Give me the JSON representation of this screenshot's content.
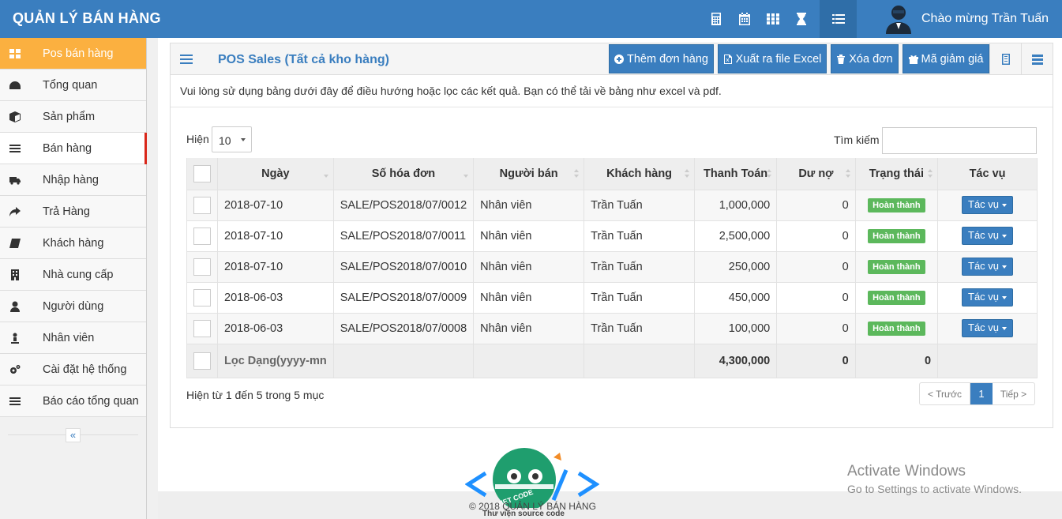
{
  "app": {
    "brand": "QUẢN LÝ BÁN HÀNG",
    "welcome": "Chào mừng Trần Tuấn",
    "top_icons": [
      "calculator-icon",
      "calendar-icon",
      "grid-icon",
      "hourglass-icon",
      "list-icon"
    ]
  },
  "sidebar": {
    "items": [
      {
        "label": "Pos bán hàng",
        "icon": "pos-icon"
      },
      {
        "label": "Tổng quan",
        "icon": "dashboard-icon"
      },
      {
        "label": "Sản phẩm",
        "icon": "box-icon"
      },
      {
        "label": "Bán hàng",
        "icon": "list-icon"
      },
      {
        "label": "Nhập hàng",
        "icon": "truck-icon"
      },
      {
        "label": "Trả Hàng",
        "icon": "share-icon"
      },
      {
        "label": "Khách hàng",
        "icon": "book-icon"
      },
      {
        "label": "Nhà cung cấp",
        "icon": "building-icon"
      },
      {
        "label": "Người dùng",
        "icon": "user-icon"
      },
      {
        "label": "Nhân viên",
        "icon": "staff-icon"
      },
      {
        "label": "Cài đặt hệ thống",
        "icon": "cogs-icon"
      },
      {
        "label": "Báo cáo tổng quan",
        "icon": "list-icon"
      }
    ],
    "collapse": "«"
  },
  "panel": {
    "title": "POS Sales (Tất cả kho hàng)",
    "buttons": {
      "add": "Thêm đơn hàng",
      "export": "Xuất ra file Excel",
      "delete": "Xóa đơn",
      "coupon": "Mã giảm giá"
    },
    "info": "Vui lòng sử dụng bảng dưới đây để điều hướng hoặc lọc các kết quả. Bạn có thể tải về bảng như excel và pdf.",
    "show_label": "Hiện",
    "page_size": "10",
    "search_label": "Tìm kiếm",
    "search_value": ""
  },
  "table": {
    "headers": [
      "Ngày",
      "Số hóa đơn",
      "Người bán",
      "Khách hàng",
      "Thanh Toán",
      "Dư nợ",
      "Trạng thái",
      "Tác vụ"
    ],
    "rows": [
      {
        "date": "2018-07-10",
        "invoice": "SALE/POS2018/07/0012",
        "seller": "Nhân viên",
        "customer": "Trần Tuấn",
        "paid": "1,000,000",
        "debt": "0",
        "status": "Hoàn thành",
        "action": "Tác vụ"
      },
      {
        "date": "2018-07-10",
        "invoice": "SALE/POS2018/07/0011",
        "seller": "Nhân viên",
        "customer": "Trần Tuấn",
        "paid": "2,500,000",
        "debt": "0",
        "status": "Hoàn thành",
        "action": "Tác vụ"
      },
      {
        "date": "2018-07-10",
        "invoice": "SALE/POS2018/07/0010",
        "seller": "Nhân viên",
        "customer": "Trần Tuấn",
        "paid": "250,000",
        "debt": "0",
        "status": "Hoàn thành",
        "action": "Tác vụ"
      },
      {
        "date": "2018-06-03",
        "invoice": "SALE/POS2018/07/0009",
        "seller": "Nhân viên",
        "customer": "Trần Tuấn",
        "paid": "450,000",
        "debt": "0",
        "status": "Hoàn thành",
        "action": "Tác vụ"
      },
      {
        "date": "2018-06-03",
        "invoice": "SALE/POS2018/07/0008",
        "seller": "Nhân viên",
        "customer": "Trần Tuấn",
        "paid": "100,000",
        "debt": "0",
        "status": "Hoàn thành",
        "action": "Tác vụ"
      }
    ],
    "footer": {
      "filter": "Lọc Dạng(yyyy-mn",
      "paid_total": "4,300,000",
      "debt_total": "0",
      "status_total": "0"
    }
  },
  "pagination": {
    "summary": "Hiện từ 1 đến 5 trong 5 mục",
    "prev": "< Trước",
    "current": "1",
    "next": "Tiếp >"
  },
  "footer": {
    "copyright": "© 2018 QUẢN LÝ BÁN HÀNG",
    "watermark_sub": "Thư viện source code",
    "logo_text": "VIET CODE"
  },
  "activate": {
    "line1": "Activate Windows",
    "line2": "Go to Settings to activate Windows."
  },
  "colors": {
    "primary": "#3a7ebf",
    "accent": "#fbb040",
    "success": "#5cb85c",
    "danger": "#d9271a"
  }
}
